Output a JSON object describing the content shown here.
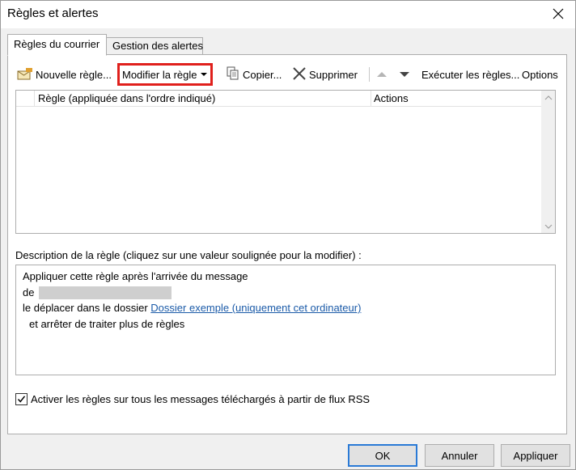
{
  "window": {
    "title": "Règles et alertes"
  },
  "tabs": [
    {
      "label": "Règles du courrier",
      "active": true
    },
    {
      "label": "Gestion des alertes",
      "active": false
    }
  ],
  "toolbar": {
    "new_rule": "Nouvelle règle...",
    "modify_rule": "Modifier la règle",
    "copy": "Copier...",
    "delete": "Supprimer",
    "run_rules": "Exécuter les règles...",
    "options": "Options"
  },
  "rules_table": {
    "columns": [
      "Règle (appliquée dans l'ordre indiqué)",
      "Actions"
    ],
    "rows": []
  },
  "description": {
    "label": "Description de la règle (cliquez sur une valeur soulignée pour la modifier) :",
    "line1": "Appliquer cette règle après l'arrivée du message",
    "line2_prefix": "de",
    "line3_prefix": "le déplacer dans le dossier",
    "line3_link": "Dossier exemple (uniquement cet ordinateur)",
    "line4": "et arrêter de traiter plus de règles"
  },
  "rss_checkbox": {
    "label": "Activer les règles sur tous les messages téléchargés à partir de flux RSS",
    "checked": true
  },
  "buttons": {
    "ok": "OK",
    "cancel": "Annuler",
    "apply": "Appliquer"
  },
  "colors": {
    "highlight": "#e0201c",
    "link": "#1a5aa8",
    "default_button_border": "#2a7ad6"
  }
}
